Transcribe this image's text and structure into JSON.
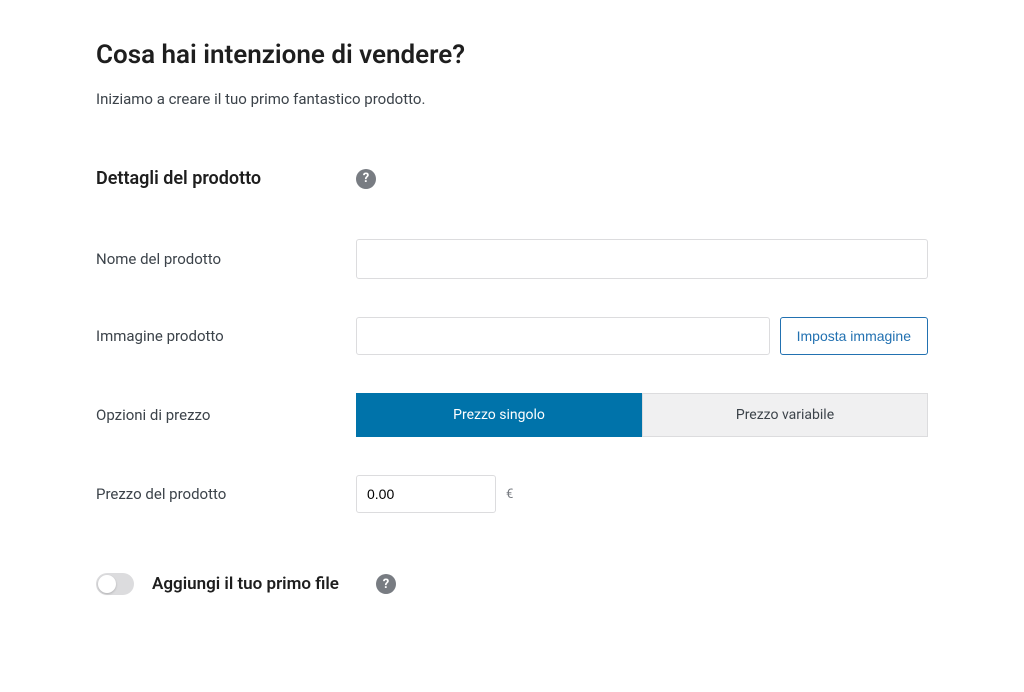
{
  "header": {
    "title": "Cosa hai intenzione di vendere?",
    "subtitle": "Iniziamo a creare il tuo primo fantastico prodotto."
  },
  "product_details": {
    "section_title": "Dettagli del prodotto",
    "help_text": "?",
    "fields": {
      "name": {
        "label": "Nome del prodotto",
        "value": ""
      },
      "image": {
        "label": "Immagine prodotto",
        "value": "",
        "button_label": "Imposta immagine"
      },
      "price_options": {
        "label": "Opzioni di prezzo",
        "options": {
          "single": "Prezzo singolo",
          "variable": "Prezzo variabile"
        },
        "selected": "single"
      },
      "price": {
        "label": "Prezzo del prodotto",
        "value": "0.00",
        "currency": "€"
      }
    }
  },
  "file_section": {
    "title": "Aggiungi il tuo primo file",
    "toggle_state": false,
    "help_text": "?"
  }
}
